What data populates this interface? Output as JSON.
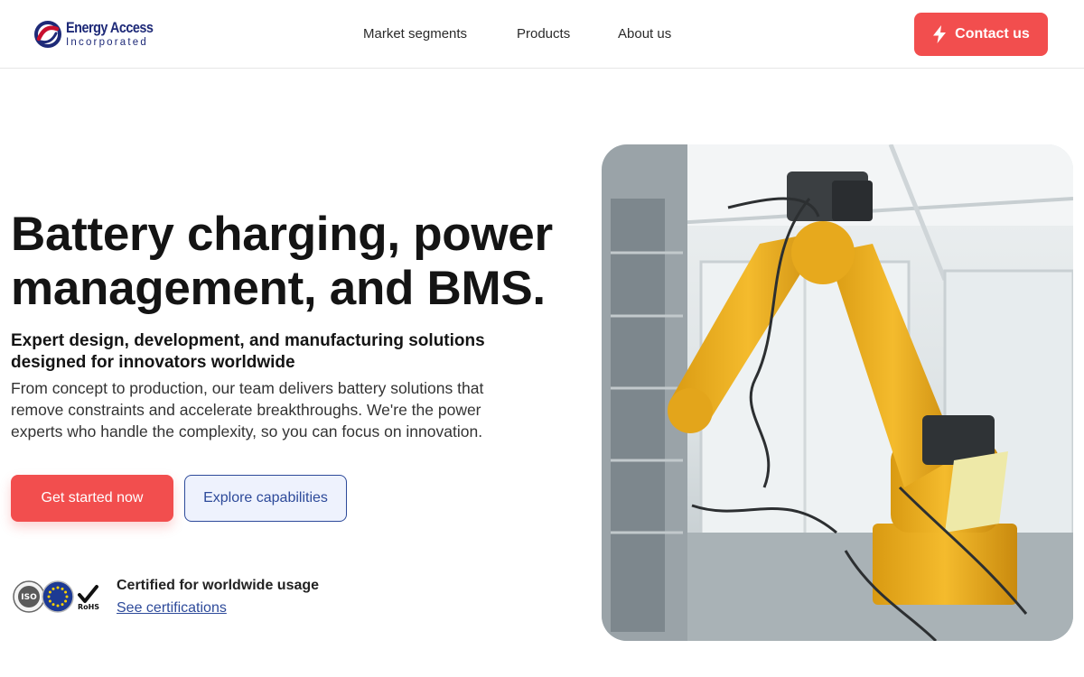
{
  "brand": {
    "name": "Energy Access",
    "subname": "Incorporated",
    "logo_icon": "ea-logo-icon",
    "colors": {
      "navy": "#1e2a78",
      "red": "#c8102e"
    }
  },
  "nav": {
    "items": [
      {
        "label": "Market segments"
      },
      {
        "label": "Products"
      },
      {
        "label": "About us"
      }
    ],
    "contact_label": "Contact us",
    "contact_icon": "lightning-icon"
  },
  "hero": {
    "title": "Battery charging, power management, and BMS.",
    "subtitle": "Expert design, development, and manufacturing solutions designed for innovators worldwide",
    "description": "From concept to production, our team delivers battery solutions that remove constraints and accelerate breakthroughs. We're the power experts who handle the complexity, so you can focus on innovation.",
    "primary_cta": "Get started now",
    "secondary_cta": "Explore capabilities",
    "image_icon": "industrial-robot-arm-photo"
  },
  "certifications": {
    "title": "Certified for worldwide usage",
    "link": "See certifications",
    "badges": [
      {
        "icon": "iso-badge-icon",
        "text": "ISO"
      },
      {
        "icon": "ce-eu-badge-icon"
      },
      {
        "icon": "rohs-badge-icon",
        "text": "RoHS"
      }
    ]
  },
  "colors": {
    "accent": "#f24e4e",
    "link": "#2d4a9a",
    "secondary_bg": "#eef2fd",
    "robot": "#f2b82c"
  }
}
